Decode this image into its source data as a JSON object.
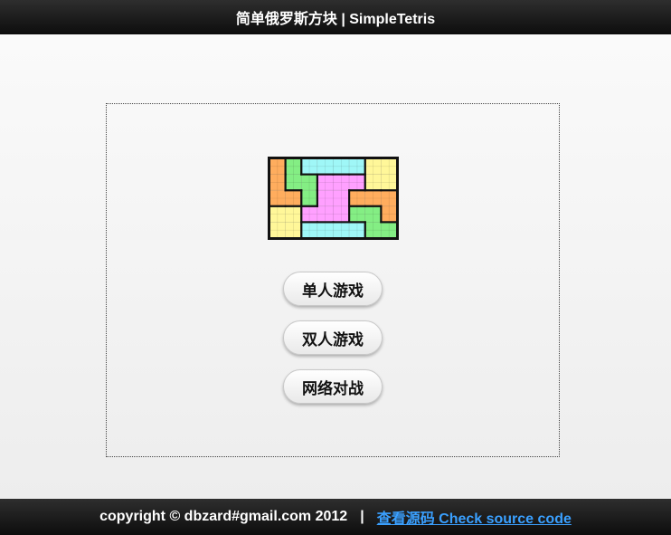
{
  "header": {
    "title": "简单俄罗斯方块 | SimpleTetris"
  },
  "logo": {
    "grid_cols": 8,
    "grid_rows": 5,
    "colors": {
      "O": "#fff799",
      "L": "#ffad5e",
      "S": "#84ee84",
      "I": "#9ff7f7",
      "T": "#ffa0ff",
      "G": "#84ee84"
    },
    "rows": [
      "LSIIIIOO",
      "LSSTTTOO",
      "LLSTTLLL",
      "OOTTTGGL",
      "OOIIIIGG"
    ]
  },
  "menu": {
    "single_player": "单人游戏",
    "two_player": "双人游戏",
    "online_battle": "网络对战"
  },
  "footer": {
    "copyright": "copyright © dbzard#gmail.com 2012",
    "separator": "|",
    "source_link": "查看源码 Check source code"
  }
}
